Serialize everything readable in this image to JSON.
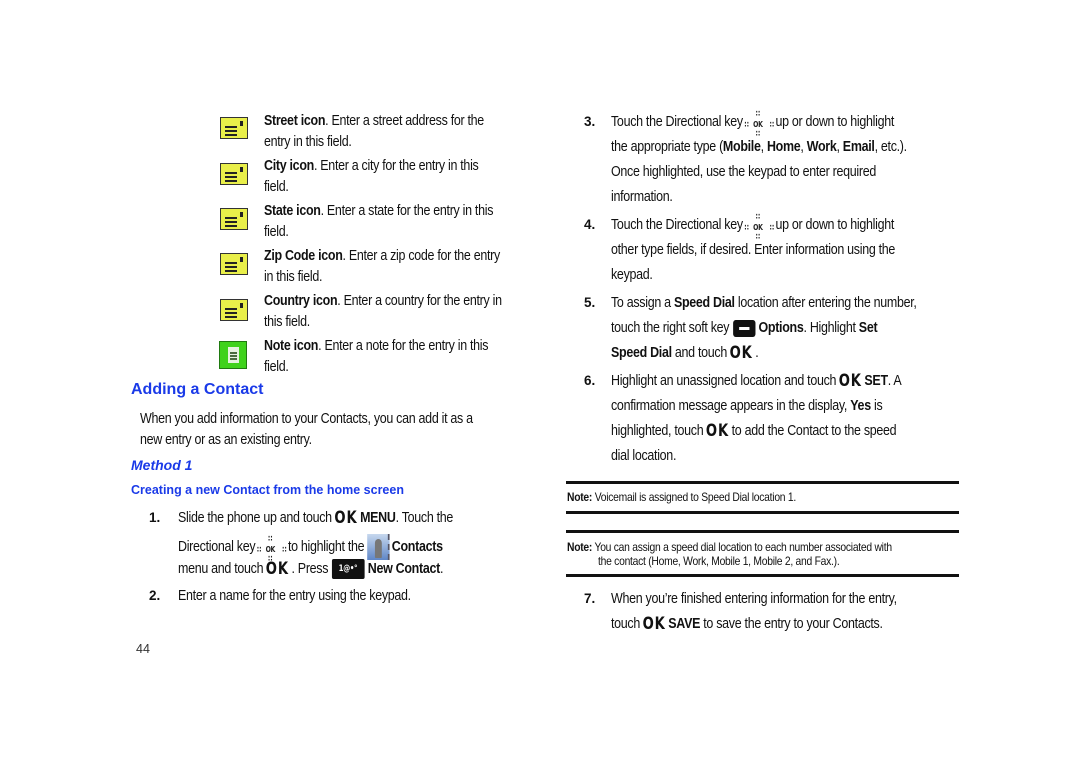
{
  "field_icons": [
    {
      "icon": "street-icon",
      "term": "Street icon",
      "line1": ". Enter a street address for the",
      "line2": "entry in this field."
    },
    {
      "icon": "city-icon",
      "term": "City icon",
      "line1": ". Enter a city for the entry in this",
      "line2": "field."
    },
    {
      "icon": "state-icon",
      "term": "State icon",
      "line1": ". Enter a state for the entry in this",
      "line2": "field."
    },
    {
      "icon": "zip-code-icon",
      "term": "Zip Code icon",
      "line1": ". Enter a zip code for the entry",
      "line2": "in this field."
    },
    {
      "icon": "country-icon",
      "term": "Country icon",
      "line1": ". Enter a country for the entry in",
      "line2": "this field."
    },
    {
      "icon": "note-icon",
      "term": "Note icon",
      "line1": ". Enter a note for the entry in this",
      "line2": "field."
    }
  ],
  "section": {
    "title": "Adding a Contact",
    "intro_line1": "When you add information to your Contacts, you can add it as a",
    "intro_line2": "new entry or as an existing entry.",
    "method_title": "Method 1",
    "subheading": "Creating a new Contact from the home screen"
  },
  "glyphs": {
    "ok": "OK",
    "dir_center": "OK",
    "dir_dots": "∷",
    "new_key": "1@•°"
  },
  "steps": {
    "s1": {
      "num": "1.",
      "a": "Slide the phone up and touch",
      "b": "MENU",
      "c": ". Touch the",
      "d": "Directional key",
      "e": "to highlight the",
      "f": "Contacts",
      "g": "menu and touch",
      "h": ". Press",
      "i": "New Contact",
      "j": "."
    },
    "s2": {
      "num": "2.",
      "text": "Enter a name for the entry using the keypad."
    },
    "s3": {
      "num": "3.",
      "a": "Touch the Directional key",
      "b": "up or down to highlight",
      "c": "the appropriate type (",
      "mobile": "Mobile",
      "sep1": ", ",
      "home": "Home",
      "sep2": ", ",
      "work": "Work",
      "sep3": ", ",
      "email": "Email",
      "d": ", etc.).",
      "e": "Once highlighted, use the keypad to enter required",
      "f": "information."
    },
    "s4": {
      "num": "4.",
      "a": "Touch the Directional key",
      "b": "up or down to highlight",
      "c": "other type fields, if desired. Enter information using the",
      "d": "keypad."
    },
    "s5": {
      "num": "5.",
      "a": "To assign a ",
      "b": "Speed Dial",
      "c": " location after entering the number,",
      "d": "touch the right soft key",
      "e": "Options",
      "f": ". Highlight ",
      "g": "Set",
      "h": "Speed Dial",
      "i": " and touch",
      "j": "."
    },
    "s6": {
      "num": "6.",
      "a": "Highlight an unassigned location and touch",
      "b": "SET",
      "c": ". A",
      "d": "confirmation message appears in the display, ",
      "e": "Yes",
      "f": " is",
      "g": "highlighted, touch",
      "h": "to add the Contact to the speed",
      "i": "dial location."
    },
    "s7": {
      "num": "7.",
      "a": "When you’re finished entering information for the entry,",
      "b": "touch",
      "c": "SAVE",
      "d": " to save the entry to your Contacts."
    }
  },
  "notes": [
    {
      "label": "Note:",
      "line1": " Voicemail is assigned to Speed Dial location 1.",
      "line2": ""
    },
    {
      "label": "Note:",
      "line1": " You can assign a speed dial location to each number associated with",
      "line2": "the contact (Home, Work, Mobile 1, Mobile 2, and Fax.)."
    }
  ],
  "page_number": "44"
}
